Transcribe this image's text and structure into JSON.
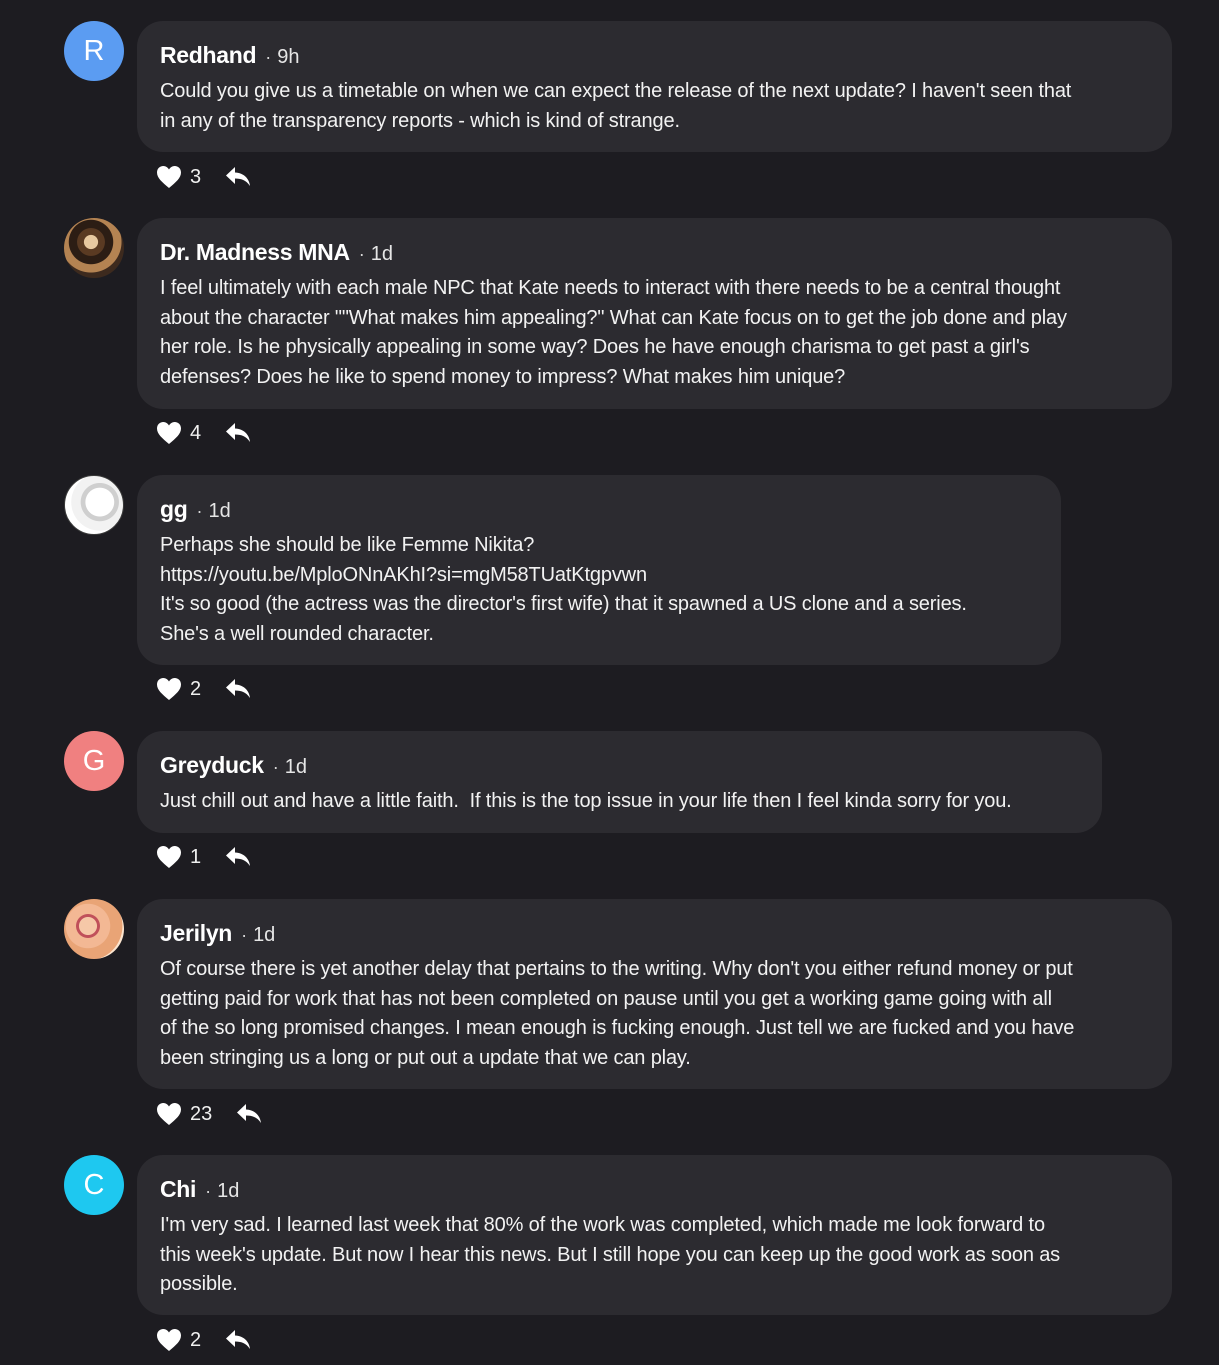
{
  "comments": [
    {
      "author": "Redhand",
      "avatar_letter": "R",
      "avatar_color": "#5b9cf2",
      "time": "9h",
      "body": "Could you give us a timetable on when we can expect the release of the next update? I haven't seen that\nin any of the transparency reports - which is kind of strange.",
      "likes": "3"
    },
    {
      "author": "Dr. Madness MNA",
      "avatar_letter": "",
      "time": "1d",
      "body": "I feel ultimately with each male NPC that Kate needs to interact with there needs to be a central thought\nabout the character \"\"What makes him appealing?\" What can Kate focus on to get the job done and play\nher role. Is he physically appealing in some way? Does he have enough charisma to get past a girl's\ndefenses? Does he like to spend money to impress? What makes him unique?",
      "likes": "4"
    },
    {
      "author": "gg",
      "avatar_letter": "",
      "time": "1d",
      "body": "Perhaps she should be like Femme Nikita?\nhttps://youtu.be/MploONnAKhI?si=mgM58TUatKtgpvwn\nIt's so good (the actress was the director's first wife) that it spawned a US clone and a series.\nShe's a well rounded character.",
      "likes": "2"
    },
    {
      "author": "Greyduck",
      "avatar_letter": "G",
      "avatar_color": "#f08080",
      "time": "1d",
      "body": "Just chill out and have a little faith.  If this is the top issue in your life then I feel kinda sorry for you.",
      "likes": "1"
    },
    {
      "author": "Jerilyn",
      "avatar_letter": "",
      "time": "1d",
      "body": "Of course there is yet another delay that pertains to the writing. Why don't you either refund money or put\ngetting paid for work that has not been completed on pause until you get a working game going with all\nof the so long promised changes. I mean enough is fucking enough. Just tell we are fucked and you have\nbeen stringing us a long or put out a update that we can play.",
      "likes": "23"
    },
    {
      "author": "Chi",
      "avatar_letter": "C",
      "avatar_color": "#1ec8f0",
      "time": "1d",
      "body": "I'm very sad. I learned last week that 80% of the work was completed, which made me look forward to\nthis week's update. But now I hear this news. But I still hope you can keep up the good work as soon as\npossible.",
      "likes": "2"
    }
  ]
}
